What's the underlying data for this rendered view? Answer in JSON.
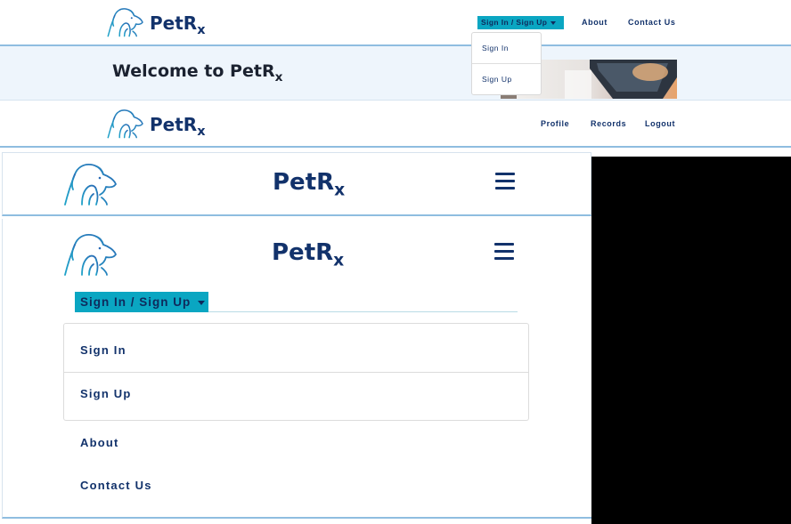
{
  "brand": {
    "name": "PetR",
    "subscript": "x",
    "colors": {
      "navy": "#12326b",
      "teal": "#0aa6c2",
      "logo_teal": "#1fa3c9",
      "logo_blue": "#2a6bb5"
    }
  },
  "public_nav": {
    "auth_toggle_label": "Sign In / Sign Up",
    "dropdown_items": [
      "Sign In",
      "Sign Up"
    ],
    "links": [
      "About",
      "Contact Us"
    ]
  },
  "welcome": {
    "title": "Welcome to PetR",
    "title_subscript": "x"
  },
  "user_nav": {
    "links": [
      "Profile",
      "Records",
      "Logout"
    ]
  },
  "mobile_nav": {
    "menu_icon": "hamburger-icon",
    "auth_toggle_label": "Sign In / Sign Up",
    "dropdown_items": [
      "Sign In",
      "Sign Up"
    ],
    "links": [
      "About",
      "Contact Us"
    ]
  },
  "icons": {
    "logo": "dog-cat-logo-icon",
    "caret": "caret-down-icon"
  }
}
